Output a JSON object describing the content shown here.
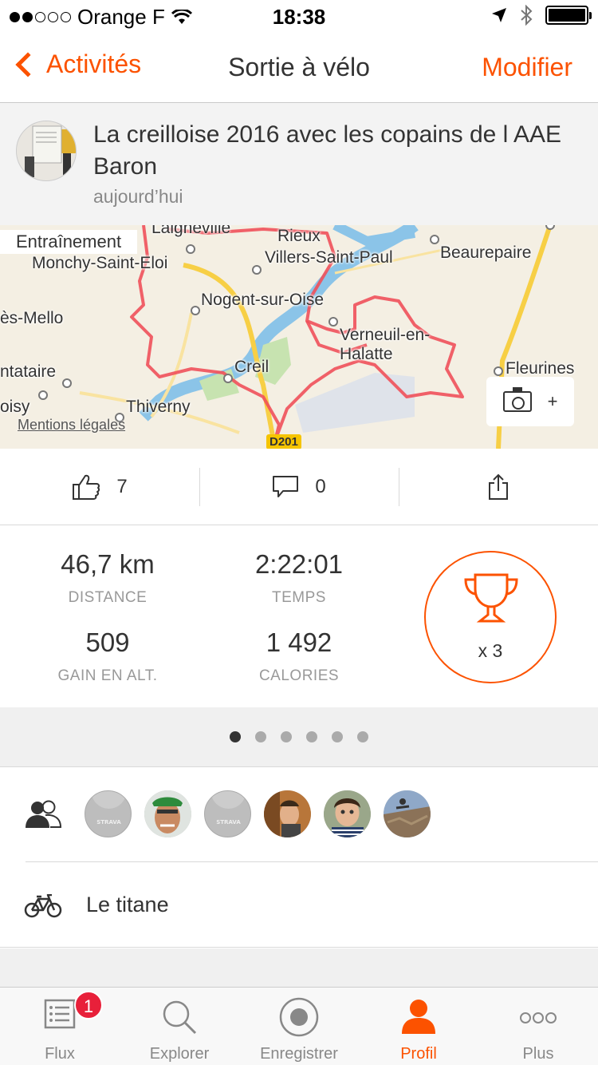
{
  "status_bar": {
    "carrier": "Orange F",
    "time": "18:38"
  },
  "nav": {
    "back_label": "Activités",
    "title": "Sortie à vélo",
    "edit_label": "Modifier"
  },
  "activity": {
    "title": "La creilloise 2016 avec les copains de l AAE Baron",
    "date": "aujourd’hui"
  },
  "map": {
    "training_label": "Entraînement",
    "legal": "Mentions légales",
    "road_badge": "D201",
    "places": [
      "Laigneville",
      "Rieux",
      "Monchy-Saint-Eloi",
      "Villers-Saint-Paul",
      "Beaurepaire",
      "Nogent-sur-Oise",
      "ès-Mello",
      "Verneuil-en-Halatte",
      "Creil",
      "Fleurines",
      "ntataire",
      "oisy",
      "Thiverny"
    ],
    "photo_add": "+"
  },
  "actions": {
    "likes": "7",
    "comments": "0"
  },
  "stats": {
    "distance": {
      "value": "46,7 km",
      "label": "DISTANCE"
    },
    "time": {
      "value": "2:22:01",
      "label": "TEMPS"
    },
    "elevation": {
      "value": "509",
      "label": "GAIN EN ALT."
    },
    "calories": {
      "value": "1 492",
      "label": "CALORIES"
    },
    "trophies": "x 3"
  },
  "pager": {
    "count": 6,
    "active": 0
  },
  "gear": {
    "bike": "Le titane"
  },
  "tabs": [
    {
      "label": "Flux",
      "badge": "1"
    },
    {
      "label": "Explorer"
    },
    {
      "label": "Enregistrer"
    },
    {
      "label": "Profil"
    },
    {
      "label": "Plus"
    }
  ],
  "colors": {
    "accent": "#fc5200",
    "badge": "#e8203a",
    "route": "#f0505a"
  }
}
